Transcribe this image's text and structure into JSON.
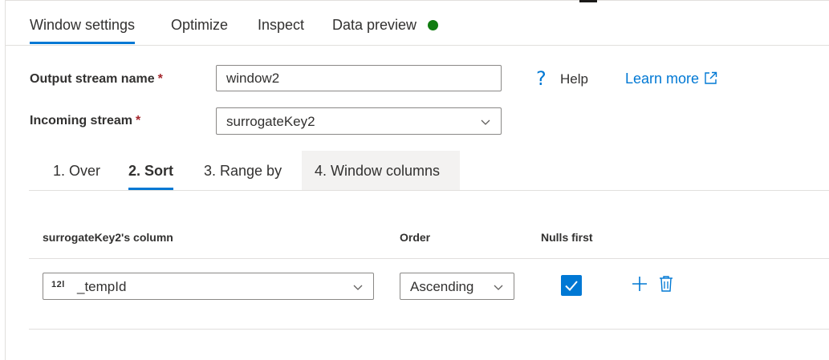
{
  "tabs": [
    {
      "label": "Window settings",
      "active": true
    },
    {
      "label": "Optimize",
      "active": false
    },
    {
      "label": "Inspect",
      "active": false
    },
    {
      "label": "Data preview",
      "active": false
    }
  ],
  "data_preview_status_color": "#107c10",
  "form": {
    "output_stream": {
      "label": "Output stream name",
      "required_mark": "*",
      "value": "window2"
    },
    "incoming_stream": {
      "label": "Incoming stream",
      "required_mark": "*",
      "value": "surrogateKey2"
    }
  },
  "help": {
    "label": "Help",
    "icon": "question-icon"
  },
  "learn_more": {
    "label": "Learn more",
    "icon": "external-link-icon"
  },
  "sub_tabs": [
    {
      "label": "1. Over",
      "active": false
    },
    {
      "label": "2. Sort",
      "active": true
    },
    {
      "label": "3. Range by",
      "active": false
    },
    {
      "label": "4. Window columns",
      "active": false,
      "hovered": true
    }
  ],
  "sort_table": {
    "headers": {
      "column": "surrogateKey2's column",
      "order": "Order",
      "nulls_first": "Nulls first"
    },
    "rows": [
      {
        "type_badge": "12l",
        "column": "_tempId",
        "order": "Ascending",
        "nulls_first": true
      }
    ]
  },
  "colors": {
    "accent": "#0078d4",
    "required": "#a4262c",
    "text": "#323130"
  }
}
